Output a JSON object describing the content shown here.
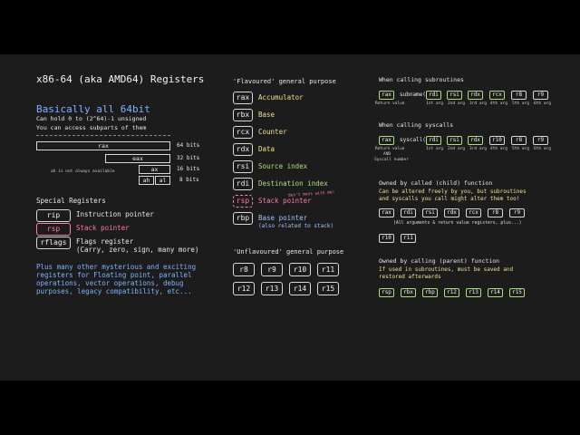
{
  "left": {
    "title": "x86-64 (aka AMD64) Registers",
    "subtitle": "Basically all 64bit",
    "line1": "Can hold 0 to (2^64)-1 unsigned",
    "line2": "You can access subparts of them",
    "bars": [
      {
        "name": "rax",
        "bits": "64 bits"
      },
      {
        "name": "eax",
        "bits": "32 bits"
      },
      {
        "name": "ax",
        "bits": "16 bits"
      },
      {
        "name": "al",
        "bits": "8 bits"
      }
    ],
    "ah": "ah",
    "ah_note": "ah is not always available",
    "special_title": "Special Registers",
    "special": [
      {
        "reg": "rip",
        "desc": "Instruction pointer"
      },
      {
        "reg": "rsp",
        "desc": "Stack pointer"
      },
      {
        "reg": "rflags",
        "desc": "Flags register"
      }
    ],
    "flags_note": "(Carry, zero, sign, many more)",
    "para": [
      "Plus many other mysterious and exciting",
      "registers for Floating point, parallel",
      "operations, vector operations, debug",
      "purposes, legacy compatibility, etc..."
    ]
  },
  "middle": {
    "flav_title": "'Flavoured' general purpose",
    "flav": [
      {
        "reg": "rax",
        "desc": "Accumulator"
      },
      {
        "reg": "rbx",
        "desc": "Base"
      },
      {
        "reg": "rcx",
        "desc": "Counter"
      },
      {
        "reg": "rdx",
        "desc": "Data"
      },
      {
        "reg": "rsi",
        "desc": "Source index"
      },
      {
        "reg": "rdi",
        "desc": "Destination index"
      },
      {
        "reg": "rsp",
        "desc": "Stack pointer"
      },
      {
        "reg": "rbp",
        "desc": "Base pointer"
      }
    ],
    "rsp_note": "don't mess with me!",
    "rbp_note": "(also related to stack)",
    "unflav_title": "'Unflavoured' general purpose",
    "unflav": [
      "r8",
      "r9",
      "r10",
      "r11",
      "r12",
      "r13",
      "r14",
      "r15"
    ]
  },
  "right": {
    "sub_title": "When calling subroutines",
    "sub_ret": "rax",
    "sub_fn": "subname(",
    "sub_args": [
      "rdi",
      "rsi",
      "rdx",
      "rcx",
      "r8",
      "r9"
    ],
    "sub_arg_labels": [
      "1st arg",
      "2nd arg",
      "3rd arg",
      "4th arg",
      "5th arg",
      "6th arg"
    ],
    "sub_ret_label": "Return value",
    "sys_title": "When calling syscalls",
    "sys_ret": "rax",
    "sys_fn": "syscall(",
    "sys_args": [
      "rdi",
      "rsi",
      "rdx",
      "r10",
      "r8",
      "r9"
    ],
    "sys_ret_label1": "Return value",
    "sys_ret_label2": "AND",
    "sys_ret_label3": "Syscall number",
    "child_title": "Owned by called (child) function",
    "child_text1": "Can be altered freely by you, but subroutines",
    "child_text2": "and syscalls you call might alter them too!",
    "child_regs": [
      "rax",
      "rdi",
      "rsi",
      "rdx",
      "rcx",
      "r8",
      "r9"
    ],
    "child_note": "(All arguments & return value registers, plus...)",
    "child_regs2": [
      "r10",
      "r11"
    ],
    "parent_title": "Owned by calling (parent) function",
    "parent_text1": "If used in subroutines, must be saved and",
    "parent_text2": "restored afterwards",
    "parent_regs": [
      "rsp",
      "rbx",
      "rbp",
      "r12",
      "r13",
      "r14",
      "r15"
    ]
  }
}
